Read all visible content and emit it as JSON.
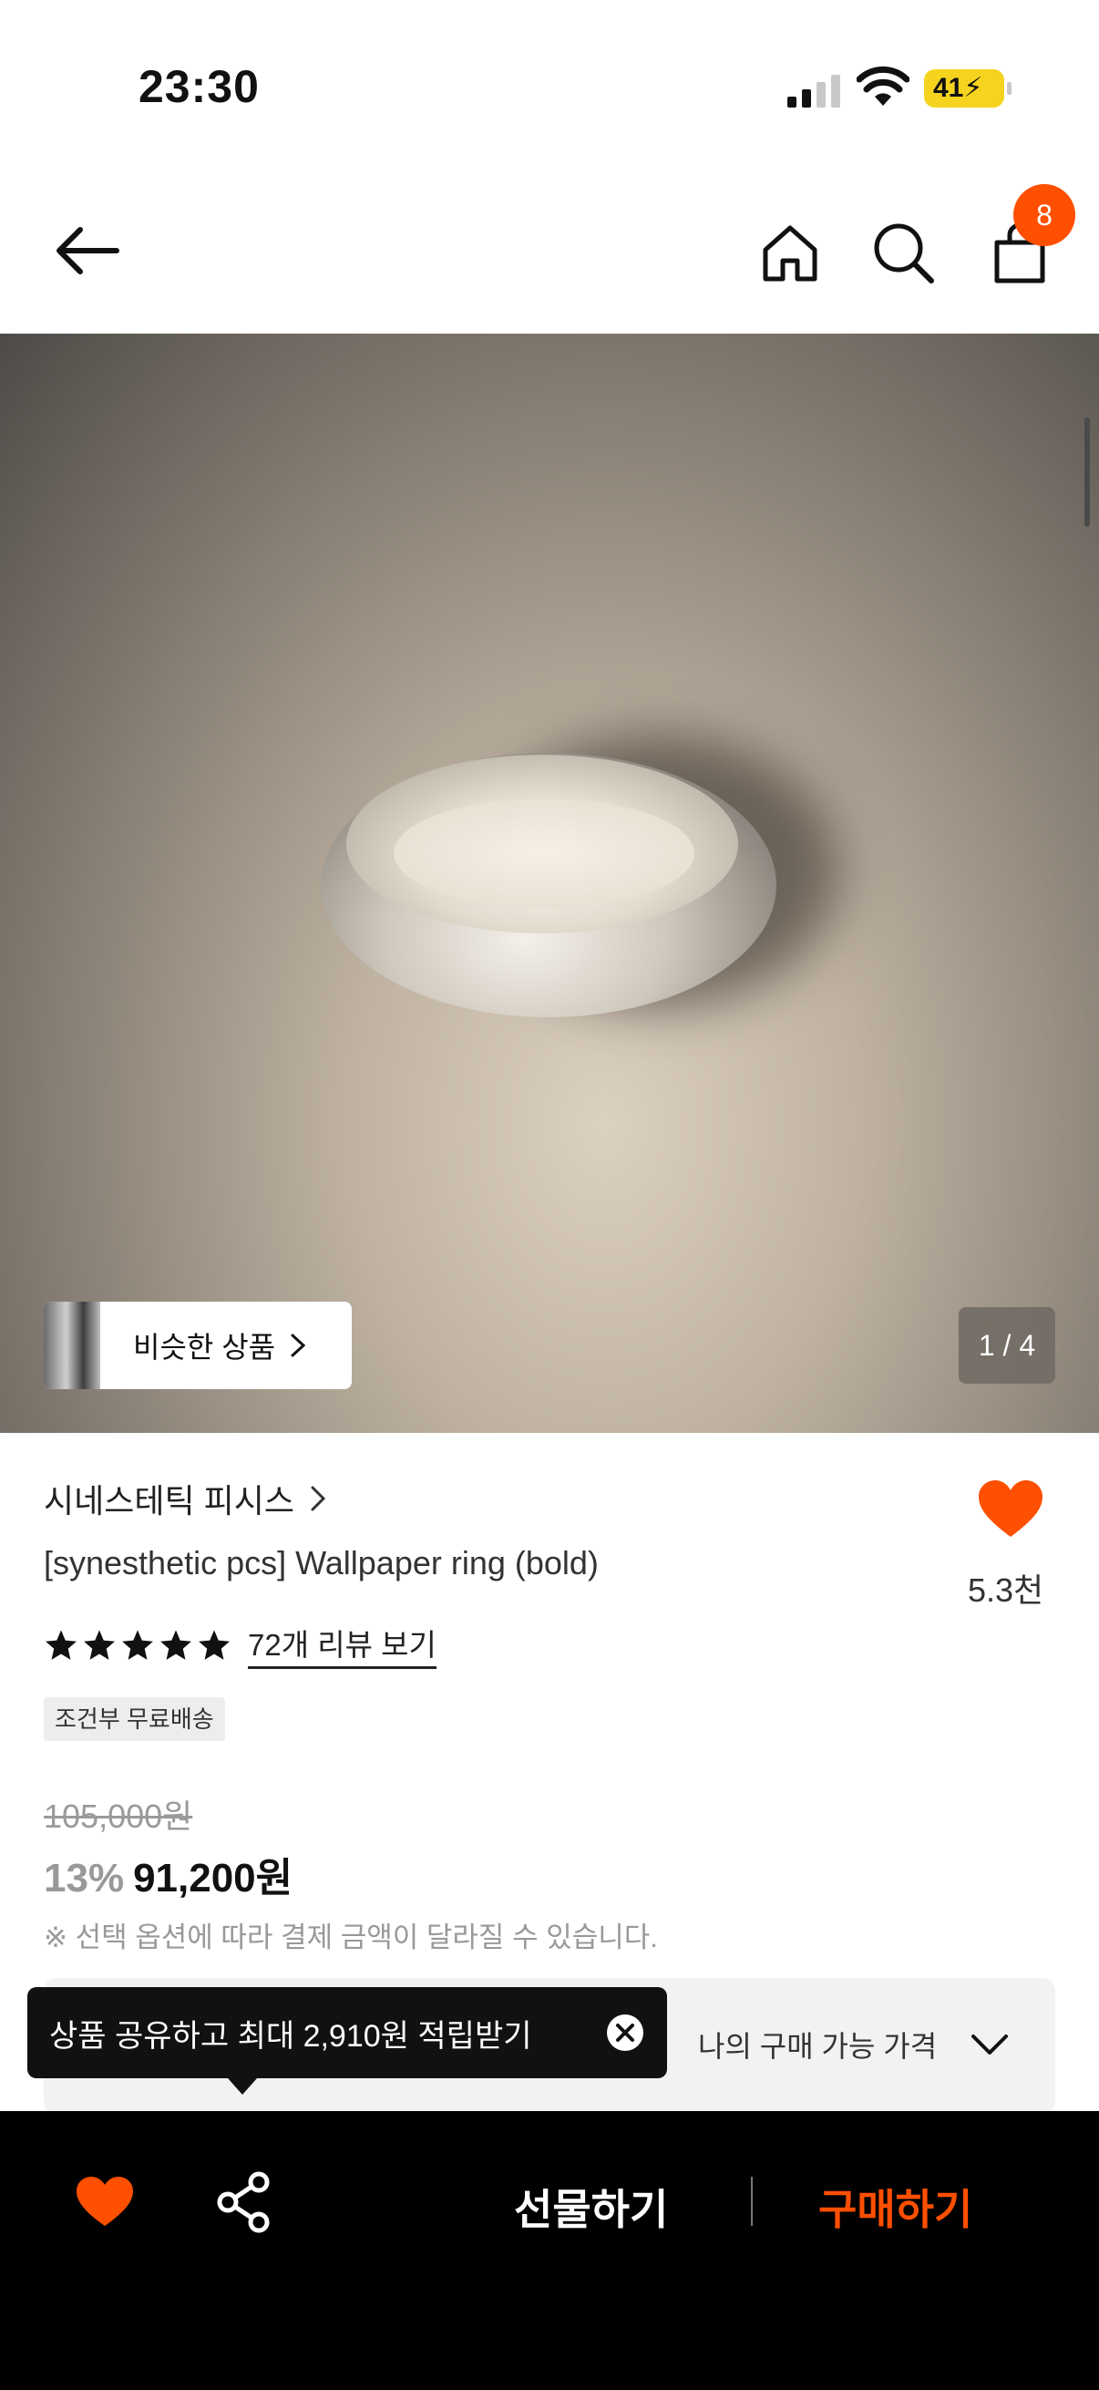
{
  "status_bar": {
    "time": "23:30",
    "battery": "41"
  },
  "header": {
    "cart_count": "8"
  },
  "gallery": {
    "similar_label": "비슷한 상품",
    "counter": "1 / 4"
  },
  "product": {
    "brand": "시네스테틱 피시스",
    "title": "[synesthetic pcs] Wallpaper ring (bold)",
    "like_count": "5.3천",
    "rating": 5,
    "review_link": "72개 리뷰 보기",
    "shipping_badge": "조건부 무료배송",
    "original_price": "105,000원",
    "discount": "13%",
    "price": "91,200원",
    "notice": "※ 선택 옵션에 따라 결제 금액이 달라질 수 있습니다."
  },
  "price_panel": {
    "label": "나의 구매 가능 가격"
  },
  "tooltip": {
    "text": "상품 공유하고 최대 2,910원 적립받기"
  },
  "bottom_bar": {
    "gift_label": "선물하기",
    "buy_label": "구매하기"
  },
  "colors": {
    "accent": "#ff4f00",
    "badge_battery": "#f5d31f"
  }
}
